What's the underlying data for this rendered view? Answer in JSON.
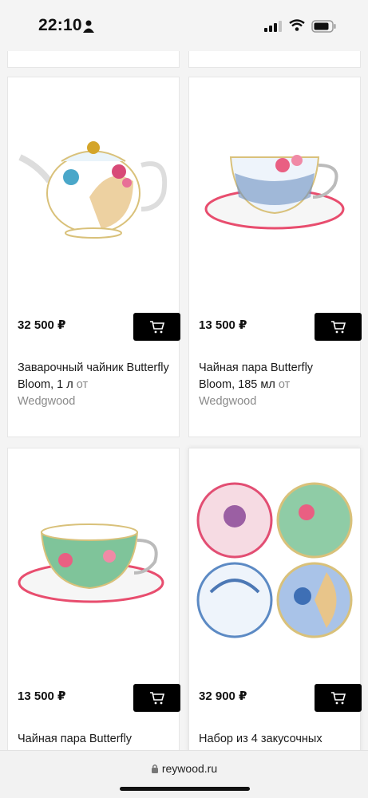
{
  "status_bar": {
    "time": "22:10"
  },
  "products": [
    {
      "price": "32 500 ₽",
      "title": "Заварочный чайник Butterfly Bloom, 1 л",
      "from": "от",
      "brand": "Wedgwood"
    },
    {
      "price": "13 500 ₽",
      "title": "Чайная пара Butterfly Bloom, 185 мл",
      "from": "от",
      "brand": "Wedgwood"
    },
    {
      "price": "13 500 ₽",
      "title": "Чайная пара Butterfly",
      "from": "",
      "brand": ""
    },
    {
      "price": "32 900 ₽",
      "title": "Набор из 4 закусочных",
      "from": "",
      "brand": ""
    }
  ],
  "browser": {
    "url": "reywood.ru"
  }
}
